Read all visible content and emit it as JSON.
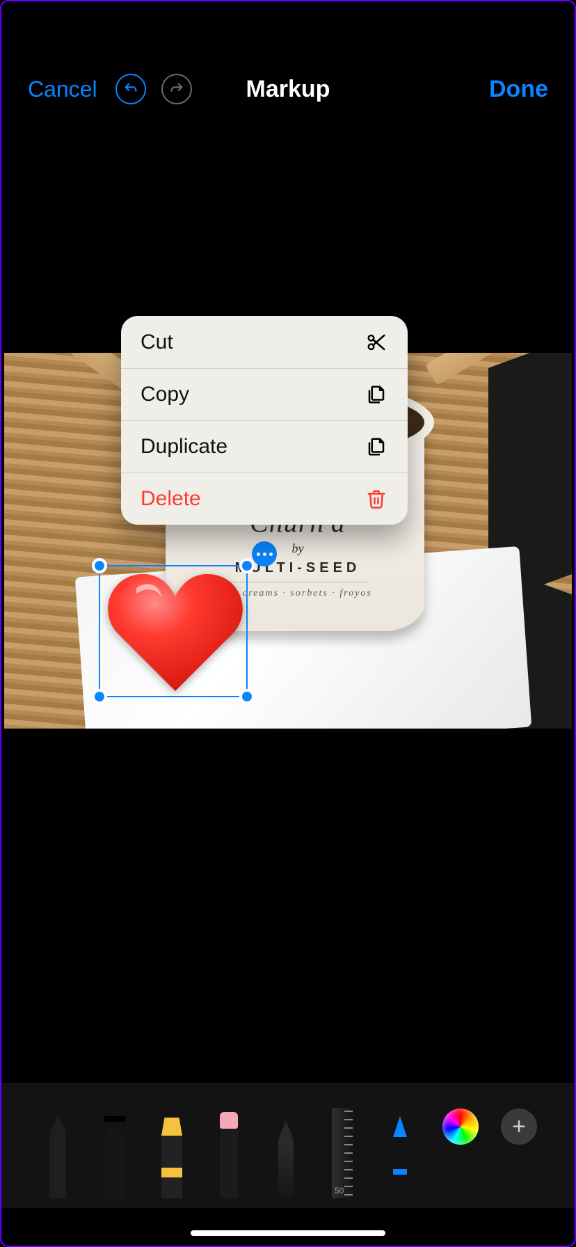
{
  "header": {
    "cancel": "Cancel",
    "title": "Markup",
    "done": "Done"
  },
  "context_menu": {
    "items": [
      {
        "label": "Cut",
        "icon": "scissors-icon",
        "destructive": false
      },
      {
        "label": "Copy",
        "icon": "documents-icon",
        "destructive": false
      },
      {
        "label": "Duplicate",
        "icon": "duplicate-icon",
        "destructive": false
      },
      {
        "label": "Delete",
        "icon": "trash-icon",
        "destructive": true
      }
    ]
  },
  "photo": {
    "cup_brand": "Churn'd",
    "cup_by": "by",
    "cup_sub": "MULTI-SEED",
    "cup_tag": "ice creams · sorbets · froyos"
  },
  "sticker": {
    "name": "red-heart"
  },
  "toolbar": {
    "tools": [
      "pen",
      "marker",
      "highlighter",
      "eraser",
      "pencil",
      "ruler",
      "brush"
    ],
    "ruler_mark": "50"
  },
  "colors": {
    "accent": "#0a84ff",
    "destructive": "#ff3b30"
  }
}
